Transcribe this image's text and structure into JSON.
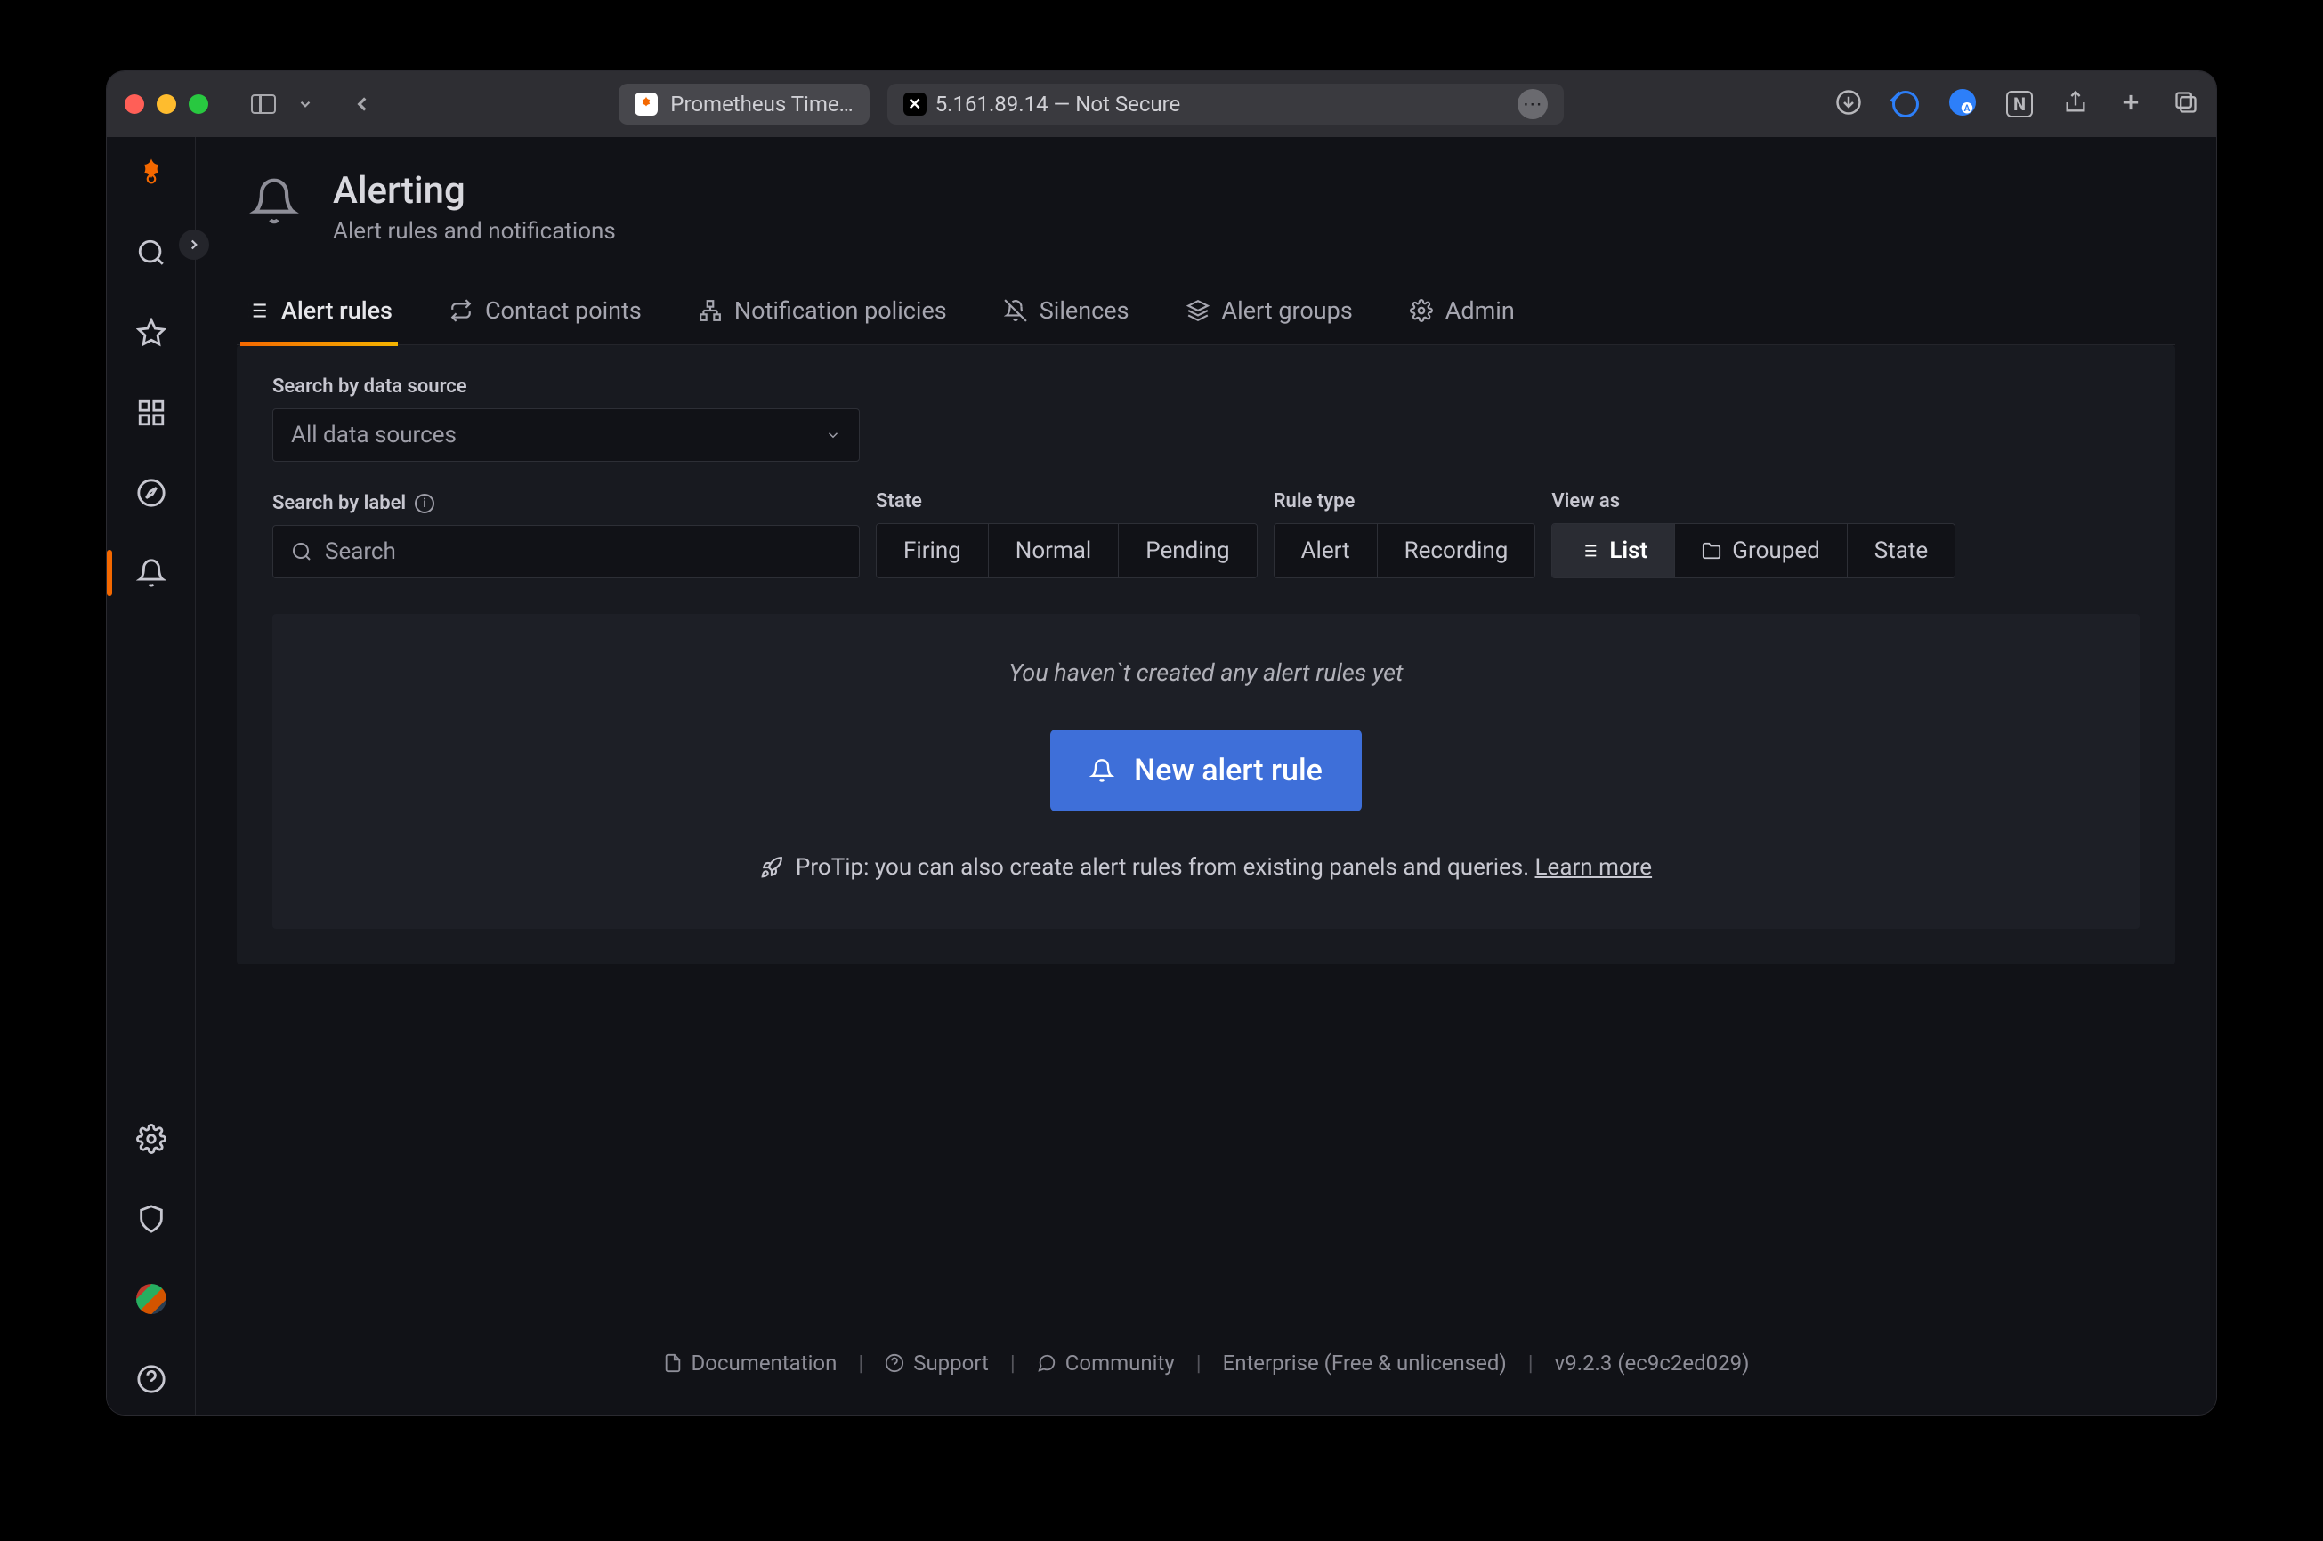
{
  "browser": {
    "tab_active": "Prometheus Time…",
    "address": "5.161.89.14 — Not Secure"
  },
  "page": {
    "title": "Alerting",
    "subtitle": "Alert rules and notifications"
  },
  "tabs": [
    {
      "label": "Alert rules"
    },
    {
      "label": "Contact points"
    },
    {
      "label": "Notification policies"
    },
    {
      "label": "Silences"
    },
    {
      "label": "Alert groups"
    },
    {
      "label": "Admin"
    }
  ],
  "filters": {
    "data_source_label": "Search by data source",
    "data_source_value": "All data sources",
    "search_label": "Search by label",
    "search_placeholder": "Search",
    "state_label": "State",
    "state_options": [
      "Firing",
      "Normal",
      "Pending"
    ],
    "rule_type_label": "Rule type",
    "rule_type_options": [
      "Alert",
      "Recording"
    ],
    "view_as_label": "View as",
    "view_as_options": [
      "List",
      "Grouped",
      "State"
    ]
  },
  "empty": {
    "message": "You haven`t created any alert rules yet",
    "button": "New alert rule",
    "protip_prefix": "ProTip: you can also create alert rules from existing panels and queries. ",
    "protip_link": "Learn more"
  },
  "footer": {
    "documentation": "Documentation",
    "support": "Support",
    "community": "Community",
    "enterprise": "Enterprise (Free & unlicensed)",
    "version": "v9.2.3 (ec9c2ed029)"
  }
}
